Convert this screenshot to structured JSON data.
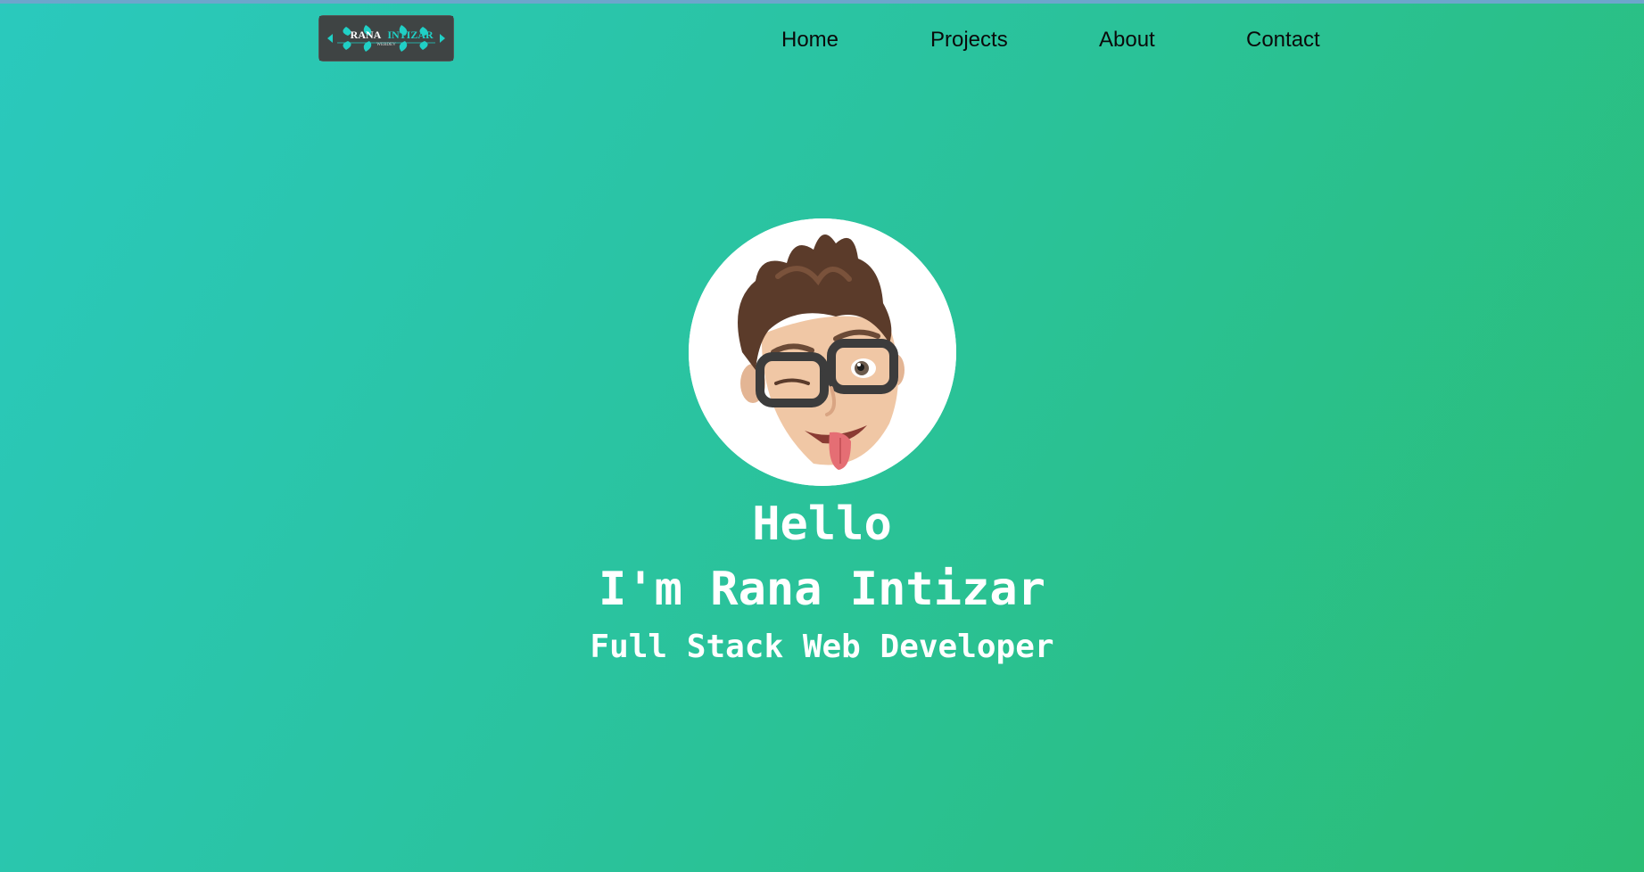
{
  "logo": {
    "brand_primary": "RANA",
    "brand_secondary": "INTIZAR",
    "tagline": "WEBDEV"
  },
  "nav": {
    "items": [
      {
        "label": "Home"
      },
      {
        "label": "Projects"
      },
      {
        "label": "About"
      },
      {
        "label": "Contact"
      }
    ]
  },
  "hero": {
    "greeting": "Hello",
    "name_line": "I'm Rana Intizar",
    "role": "Full Stack Web Developer",
    "avatar_icon": "memoji-avatar-icon"
  },
  "colors": {
    "gradient_start": "#2ac9bd",
    "gradient_end": "#2bbd74",
    "hero_text": "#ffffff",
    "nav_text": "#0a0a0a",
    "logo_bg": "#3f4444",
    "logo_accent": "#20d0c6"
  }
}
